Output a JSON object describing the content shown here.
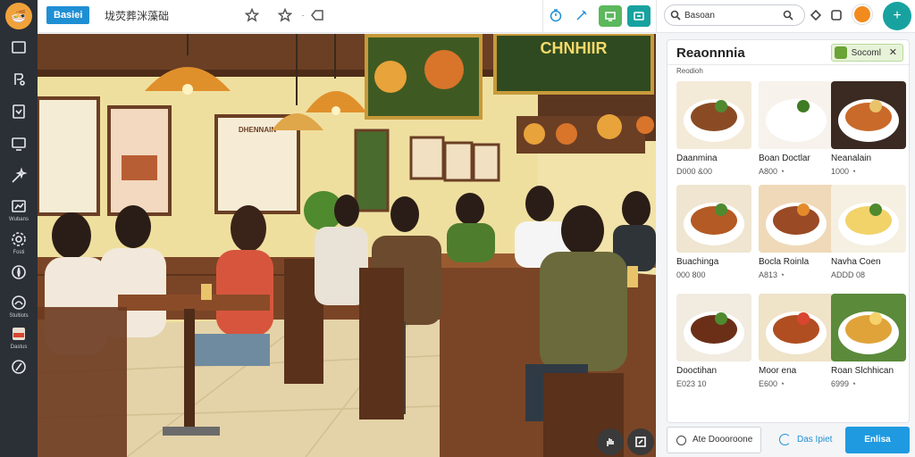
{
  "topbar": {
    "brand": "Basiei",
    "doc_title": "垅荧葬洣藻础"
  },
  "rail": {
    "items": [
      {
        "icon": "frame-icon",
        "label": ""
      },
      {
        "icon": "pen-tool-icon",
        "label": ""
      },
      {
        "icon": "template-icon",
        "label": ""
      },
      {
        "icon": "monitor-icon",
        "label": ""
      },
      {
        "icon": "magic-wand-icon",
        "label": ""
      },
      {
        "icon": "chart-icon",
        "label": "Wubans"
      },
      {
        "icon": "settings-icon",
        "label": "Fosti"
      },
      {
        "icon": "compass-icon",
        "label": ""
      },
      {
        "icon": "palette-icon",
        "label": "Stultiots"
      },
      {
        "icon": "food-icon",
        "label": "Dastus"
      },
      {
        "icon": "edit-icon",
        "label": ""
      }
    ]
  },
  "right_top": {
    "search_value": "Basoan"
  },
  "panel": {
    "title": "Reaonnnia",
    "chip_label": "Socoml",
    "subtitle": "Reodioh",
    "cards": [
      {
        "name": "Daanmina",
        "price": "D000 &00",
        "dish": "meatballs"
      },
      {
        "name": "Boan Doctlar",
        "price": "A800 ◔",
        "dish": "rice"
      },
      {
        "name": "Neanalain",
        "price": "1000 ◔",
        "dish": "chicken"
      },
      {
        "name": "Buachinga",
        "price": "000 800",
        "dish": "noodles"
      },
      {
        "name": "Bocla Roinla",
        "price": "A813 ◔",
        "dish": "stew"
      },
      {
        "name": "Navha Coen",
        "price": "ADDD 08",
        "dish": "pasta"
      },
      {
        "name": "Dooctihan",
        "price": "E023 10",
        "dish": "sausages"
      },
      {
        "name": "Moor ena",
        "price": "E600 ◔",
        "dish": "chops"
      },
      {
        "name": "Roan Slchhican",
        "price": "6999 ◔",
        "dish": "crispy"
      }
    ]
  },
  "bottom": {
    "secondary": "Ate Doooroone",
    "link": "Das Ipiet",
    "primary": "Enlisa"
  },
  "scene": {
    "menu_board_title": "DHENNAIN"
  }
}
